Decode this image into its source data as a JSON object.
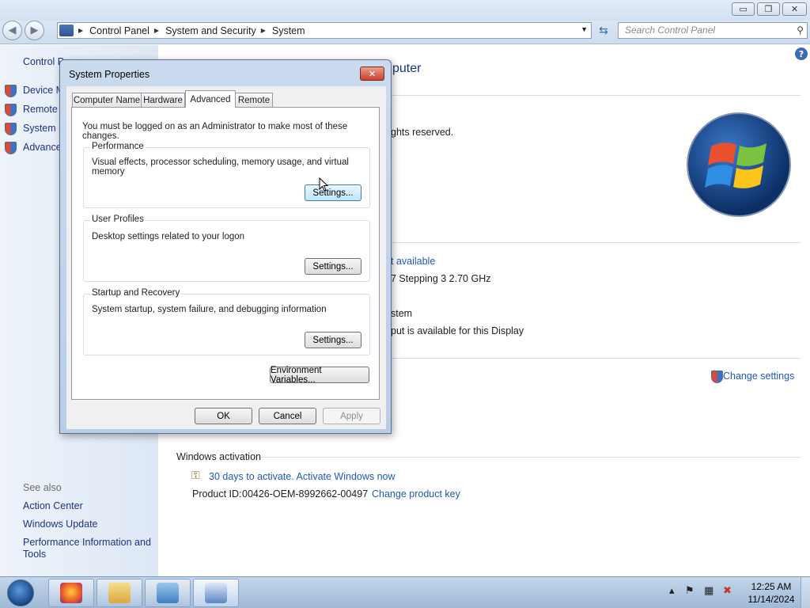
{
  "window": {
    "caption_buttons": {
      "minimize": "▭",
      "maximize": "❐",
      "close": "✕"
    }
  },
  "navbar": {
    "breadcrumbs": [
      "Control Panel",
      "System and Security",
      "System"
    ],
    "search_placeholder": "Search Control Panel"
  },
  "left_pane": {
    "home_link": "Control P",
    "links": [
      "Device M",
      "Remote s",
      "System p",
      "Advance"
    ],
    "see_also_label": "See also",
    "see_also": [
      "Action Center",
      "Windows Update",
      "Performance Information and",
      "Tools"
    ]
  },
  "main": {
    "heading_fragment": "puter",
    "copyright_fragment": "ghts reserved.",
    "rating_fragment": "t available",
    "processor_fragment": "7 Stepping 3   2.70 GHz",
    "system_type_fragment": "stem",
    "pen_fragment": "put is available for this Display",
    "change_settings": "Change settings",
    "activation_heading": "Windows activation",
    "activation_link": "30 days to activate. Activate Windows now",
    "product_id_label": "Product ID:",
    "product_id": "00426-OEM-8992662-00497",
    "change_key": "Change product key"
  },
  "dialog": {
    "title": "System Properties",
    "tabs": [
      "Computer Name",
      "Hardware",
      "Advanced",
      "Remote"
    ],
    "active_tab": "Advanced",
    "admin_note": "You must be logged on as an Administrator to make most of these changes.",
    "groups": [
      {
        "title": "Performance",
        "description": "Visual effects, processor scheduling, memory usage, and virtual memory",
        "button": "Settings..."
      },
      {
        "title": "User Profiles",
        "description": "Desktop settings related to your logon",
        "button": "Settings..."
      },
      {
        "title": "Startup and Recovery",
        "description": "System startup, system failure, and debugging information",
        "button": "Settings..."
      }
    ],
    "env_button": "Environment Variables...",
    "ok": "OK",
    "cancel": "Cancel",
    "apply": "Apply"
  },
  "taskbar": {
    "apps": [
      "firefox-icon",
      "file-explorer-icon",
      "control-panel-icon",
      "system-properties-icon"
    ],
    "time": "12:25 AM",
    "date": "11/14/2024"
  }
}
